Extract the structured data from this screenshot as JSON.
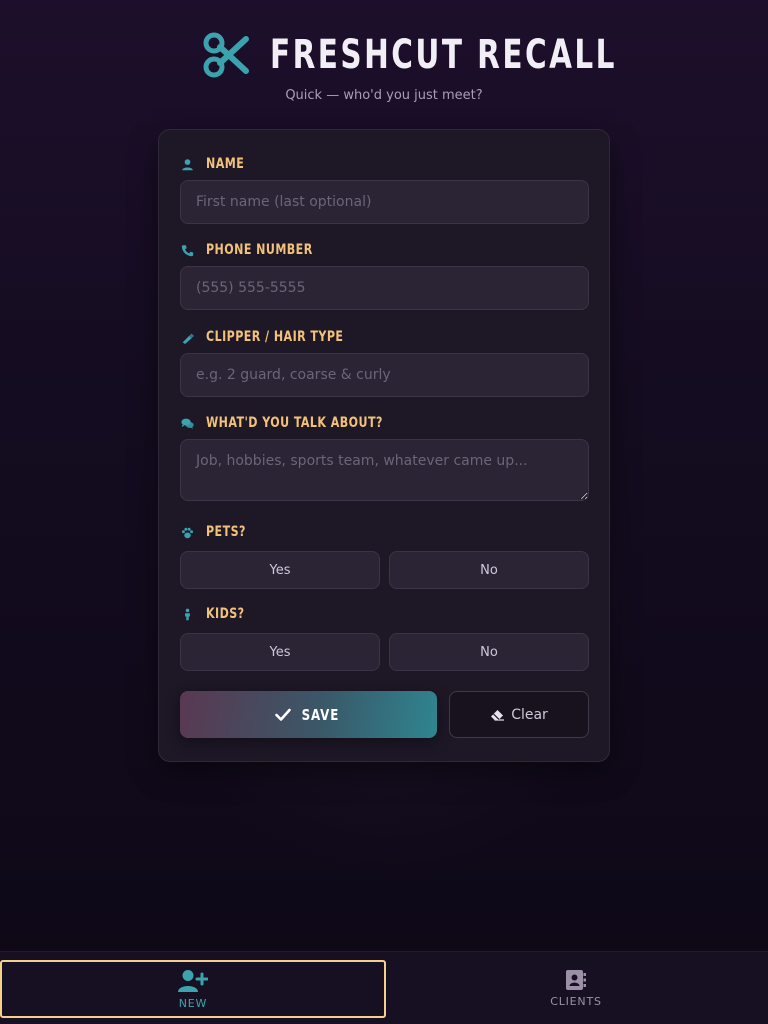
{
  "app": {
    "title": "FRESHCUT RECALL",
    "subtitle": "Quick — who'd you just meet?"
  },
  "form": {
    "name": {
      "label": "NAME",
      "placeholder": "First name (last optional)",
      "value": ""
    },
    "phone": {
      "label": "PHONE NUMBER",
      "placeholder": "(555) 555-5555",
      "value": ""
    },
    "clipper": {
      "label": "CLIPPER / HAIR TYPE",
      "placeholder": "e.g. 2 guard, coarse & curly",
      "value": ""
    },
    "talk": {
      "label": "WHAT'D YOU TALK ABOUT?",
      "placeholder": "Job, hobbies, sports team, whatever came up...",
      "value": ""
    },
    "pets": {
      "label": "PETS?",
      "yes": "Yes",
      "no": "No"
    },
    "kids": {
      "label": "KIDS?",
      "yes": "Yes",
      "no": "No"
    },
    "save_label": "SAVE",
    "clear_label": "Clear"
  },
  "nav": {
    "items": [
      {
        "label": "NEW",
        "icon": "user-plus-icon",
        "active": true
      },
      {
        "label": "CLIENTS",
        "icon": "address-book-icon",
        "active": false
      }
    ]
  },
  "colors": {
    "accent_teal": "#3aa3ad",
    "label_gold": "#f2c27a",
    "nav_active_border": "#f5d08a",
    "background": "#140c20"
  }
}
